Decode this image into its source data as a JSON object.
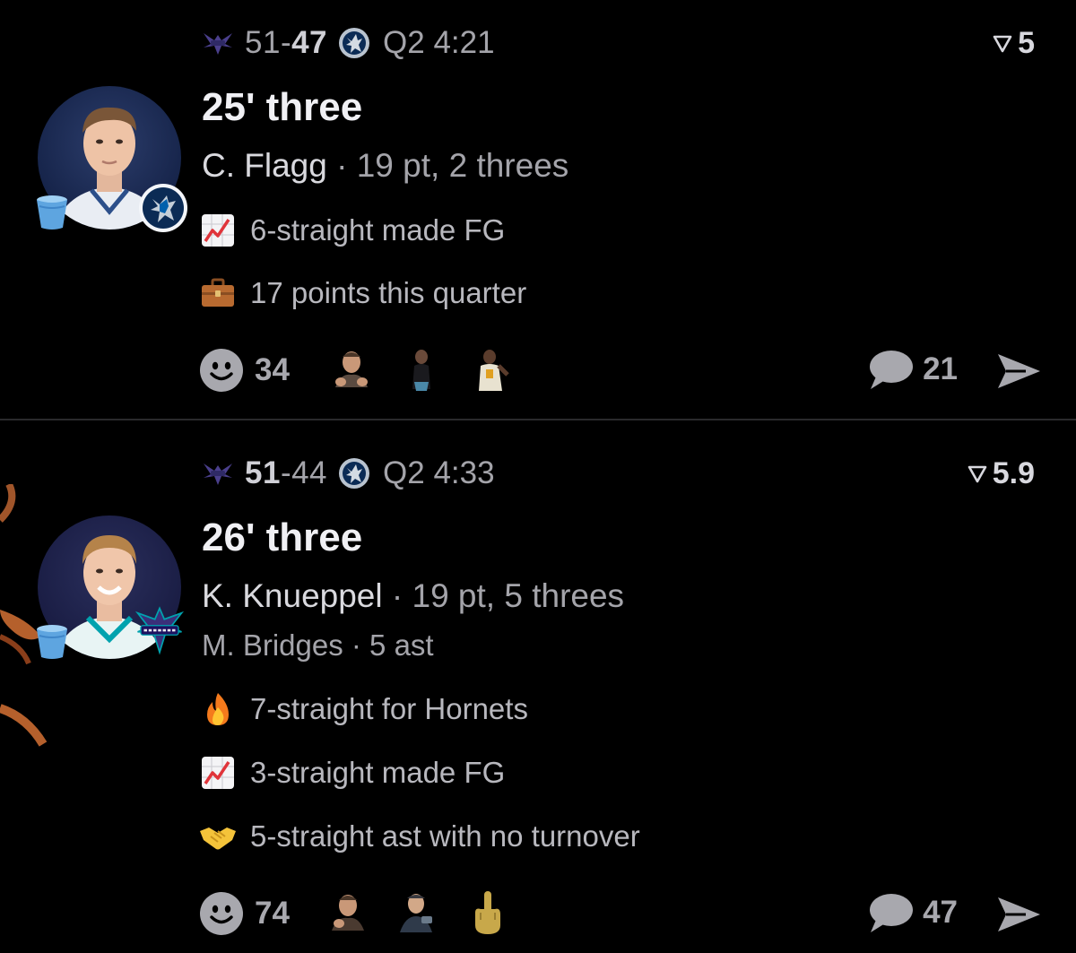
{
  "posts": [
    {
      "score_home": "51",
      "score_sep": "-",
      "score_away": "47",
      "clock": "Q2 4:21",
      "win_prob": "5",
      "title": "25' three",
      "player": "C. Flagg",
      "sep": " · ",
      "stats": "19 pt, 2 threes",
      "notes": [
        {
          "icon": "chart-increasing-icon",
          "text": "6-straight made FG"
        },
        {
          "icon": "briefcase-icon",
          "text": "17 points this quarter"
        }
      ],
      "reactions": "34",
      "comments": "21",
      "team_badge": "mavericks-logo-icon"
    },
    {
      "score_home": "51",
      "score_sep": "-",
      "score_away": "44",
      "clock": "Q2 4:33",
      "win_prob": "5.9",
      "title": "26' three",
      "player": "K. Knueppel",
      "sep": " · ",
      "stats": "19 pt, 5 threes",
      "assist_player": "M. Bridges",
      "assist_stats": "5 ast",
      "notes": [
        {
          "icon": "fire-icon",
          "text": "7-straight for Hornets"
        },
        {
          "icon": "chart-increasing-icon",
          "text": "3-straight made FG"
        },
        {
          "icon": "handshake-icon",
          "text": "5-straight ast with no turnover"
        }
      ],
      "reactions": "74",
      "comments": "47",
      "team_badge": "hornets-logo-icon"
    }
  ],
  "colors": {
    "background": "#000000",
    "divider": "#2a2a2c",
    "muted_text": "#a4a4aa",
    "primary_text": "#f0f0f4",
    "bucket": "#6aa8e0",
    "chart_red": "#e0343a"
  }
}
